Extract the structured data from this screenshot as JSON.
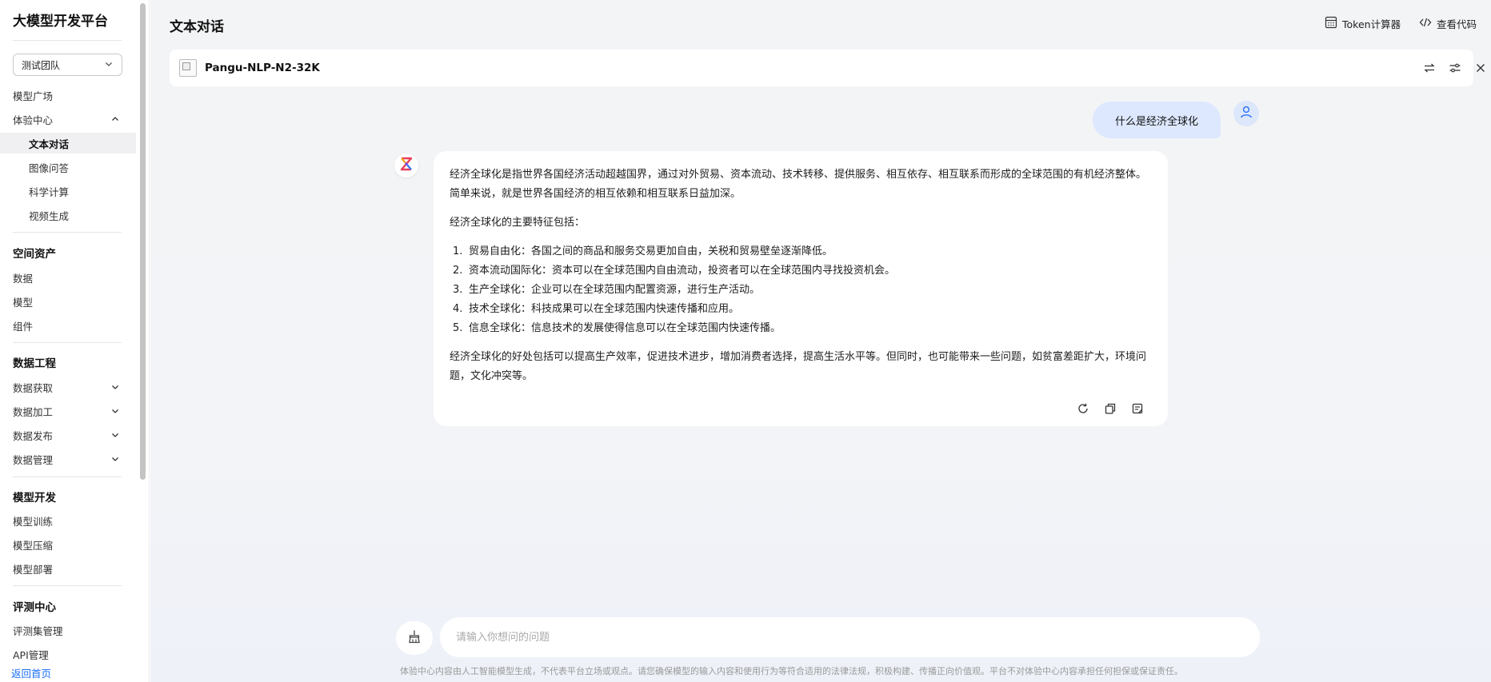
{
  "sidebar": {
    "title": "大模型开发平台",
    "team_select": "测试团队",
    "items": {
      "model_square": "模型广场",
      "experience_center": "体验中心",
      "text_chat": "文本对话",
      "image_qa": "图像问答",
      "science_calc": "科学计算",
      "video_gen": "视频生成",
      "data": "数据",
      "model": "模型",
      "component": "组件",
      "data_acquire": "数据获取",
      "data_process": "数据加工",
      "data_publish": "数据发布",
      "data_manage": "数据管理",
      "model_train": "模型训练",
      "model_compress": "模型压缩",
      "model_deploy": "模型部署",
      "eval_set_manage": "评测集管理",
      "api_manage": "API管理"
    },
    "groups": {
      "space_assets": "空间资产",
      "data_engineering": "数据工程",
      "model_dev": "模型开发",
      "eval_center": "评测中心"
    },
    "back_home": "返回首页"
  },
  "header": {
    "title": "文本对话",
    "token_calc": "Token计算器",
    "view_code": "查看代码"
  },
  "model_bar": {
    "model_name": "Pangu-NLP-N2-32K"
  },
  "chat": {
    "user_message": "什么是经济全球化",
    "ai_intro": "经济全球化是指世界各国经济活动超越国界，通过对外贸易、资本流动、技术转移、提供服务、相互依存、相互联系而形成的全球范围的有机经济整体。简单来说，就是世界各国经济的相互依赖和相互联系日益加深。",
    "ai_features_title": "经济全球化的主要特征包括：",
    "ai_features": [
      {
        "num": "1.",
        "text": "贸易自由化：各国之间的商品和服务交易更加自由，关税和贸易壁垒逐渐降低。"
      },
      {
        "num": "2.",
        "text": "资本流动国际化：资本可以在全球范围内自由流动，投资者可以在全球范围内寻找投资机会。"
      },
      {
        "num": "3.",
        "text": "生产全球化：企业可以在全球范围内配置资源，进行生产活动。"
      },
      {
        "num": "4.",
        "text": "技术全球化：科技成果可以在全球范围内快速传播和应用。"
      },
      {
        "num": "5.",
        "text": "信息全球化：信息技术的发展使得信息可以在全球范围内快速传播。"
      }
    ],
    "ai_conclusion": "经济全球化的好处包括可以提高生产效率，促进技术进步，增加消费者选择，提高生活水平等。但同时，也可能带来一些问题，如贫富差距扩大，环境问题，文化冲突等。"
  },
  "input": {
    "placeholder": "请输入你想问的问题"
  },
  "footer": {
    "disclaimer": "体验中心内容由人工智能模型生成，不代表平台立场或观点。请您确保模型的输入内容和使用行为等符合适用的法律法规，积极构建、传播正向价值观。平台不对体验中心内容承担任何担保或保证责任。"
  },
  "icons": {
    "chevron": "chevron-icon",
    "calculator": "calculator-icon",
    "code": "code-icon",
    "swap": "swap-icon",
    "settings": "sliders-icon",
    "close": "close-icon",
    "user": "user-icon",
    "ai_logo": "ai-logo-icon",
    "refresh": "refresh-icon",
    "copy": "copy-icon",
    "note": "note-icon",
    "broom": "broom-icon"
  },
  "colors": {
    "accent": "#1a6ef5",
    "user_bubble": "#dde8ff"
  }
}
